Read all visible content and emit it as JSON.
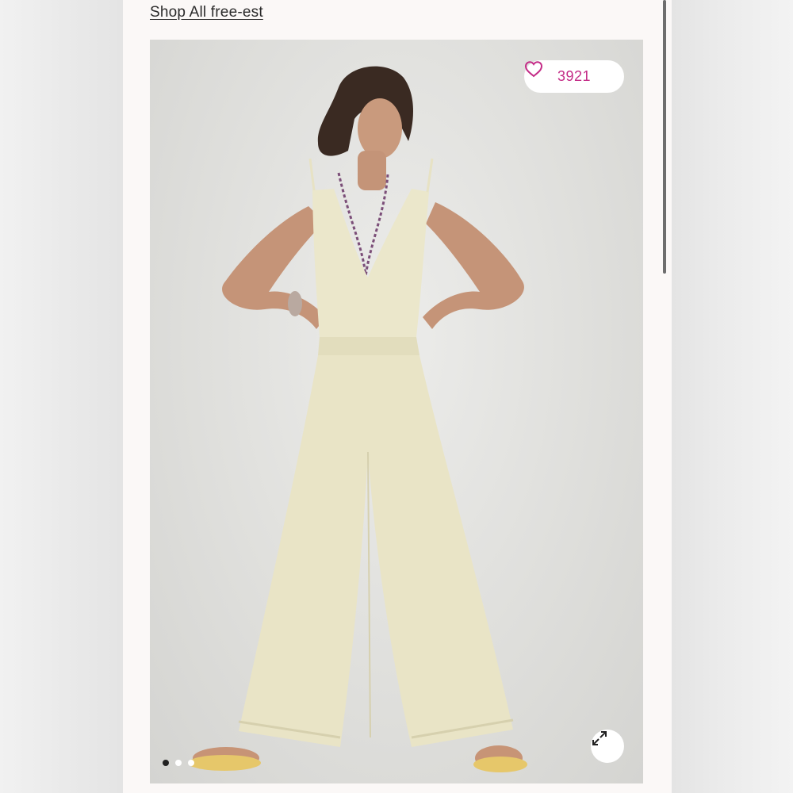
{
  "header": {
    "shop_link_label": "Shop All free-est"
  },
  "product_gallery": {
    "favorite_count": "3921",
    "current_image": 1,
    "image_count": 3,
    "icons": {
      "favorite": "heart-icon",
      "expand": "expand-arrows-icon"
    }
  },
  "colors": {
    "accent": "#c42c87",
    "page_background": "#fbf8f7",
    "dot_active": "#222222",
    "dot_inactive": "#ffffff"
  }
}
